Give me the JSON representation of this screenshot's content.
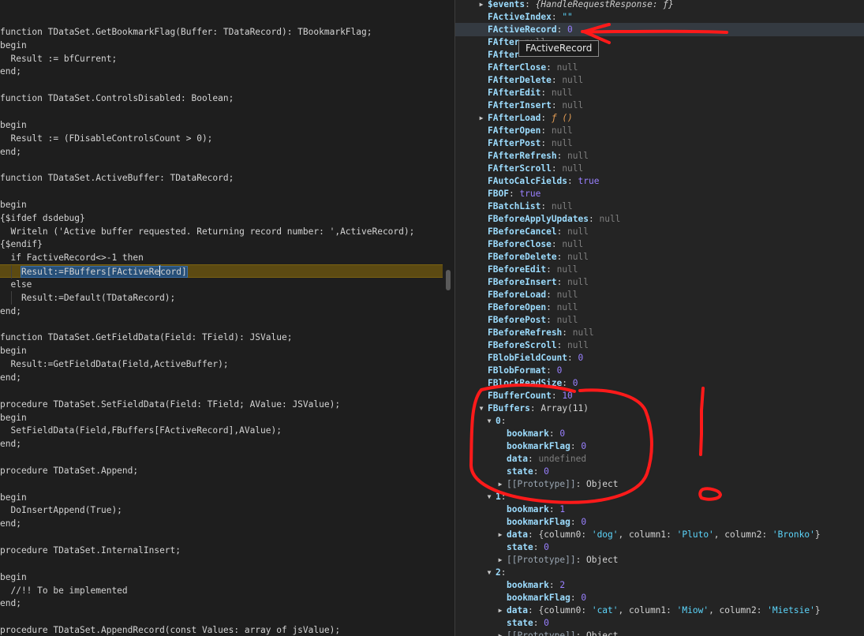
{
  "editor": {
    "lines": [
      "",
      "function TDataSet.GetBookmarkFlag(Buffer: TDataRecord): TBookmarkFlag;",
      "begin",
      "  Result := bfCurrent;",
      "end;",
      "",
      "function TDataSet.ControlsDisabled: Boolean;",
      "",
      "begin",
      "  Result := (FDisableControlsCount > 0);",
      "end;",
      "",
      "function TDataSet.ActiveBuffer: TDataRecord;",
      "",
      "begin",
      "{$ifdef dsdebug}",
      "  Writeln ('Active buffer requested. Returning record number: ',ActiveRecord);",
      "{$endif}",
      "  if FactiveRecord<>-1 then",
      "",
      "  else",
      "    Result:=Default(TDataRecord);",
      "end;",
      "",
      "function TDataSet.GetFieldData(Field: TField): JSValue;",
      "begin",
      "  Result:=GetFieldData(Field,ActiveBuffer);",
      "end;",
      "",
      "procedure TDataSet.SetFieldData(Field: TField; AValue: JSValue);",
      "begin",
      "  SetFieldData(Field,FBuffers[FActiveRecord],AValue);",
      "end;",
      "",
      "procedure TDataSet.Append;",
      "",
      "begin",
      "  DoInsertAppend(True);",
      "end;",
      "",
      "procedure TDataSet.InternalInsert;",
      "",
      "begin",
      "  //!! To be implemented",
      "end;",
      "",
      "procedure TDataSet.AppendRecord(const Values: array of jsValue);"
    ],
    "current_line": {
      "indent": "    ",
      "selected_before_caret": "Result:=FBuffers[FActiveRe",
      "selected_after_caret": "cord]"
    }
  },
  "scope": {
    "rows": [
      {
        "key": "$events",
        "sep": ": ",
        "value": "{HandleRequestResponse: ƒ}",
        "vclass": "v-italic",
        "twisty": "right"
      },
      {
        "key": "FActiveIndex",
        "sep": ": ",
        "value": "\"\"",
        "vclass": "v-str"
      },
      {
        "key": "FActiveRecord",
        "sep": ": ",
        "value": "0",
        "vclass": "v-num"
      },
      {
        "key": "FAfter",
        "sep": " ",
        "value": "null",
        "vclass": "v-null"
      },
      {
        "key": "FAfter",
        "sep": "",
        "value": "",
        "vclass": "v-null"
      },
      {
        "key": "FAfterClose",
        "sep": ": ",
        "value": "null",
        "vclass": "v-null"
      },
      {
        "key": "FAfterDelete",
        "sep": ": ",
        "value": "null",
        "vclass": "v-null"
      },
      {
        "key": "FAfterEdit",
        "sep": ": ",
        "value": "null",
        "vclass": "v-null"
      },
      {
        "key": "FAfterInsert",
        "sep": ": ",
        "value": "null",
        "vclass": "v-null"
      },
      {
        "key": "FAfterLoad",
        "sep": ": ",
        "value": "ƒ ()",
        "vclass": "v-fn",
        "twisty": "right"
      },
      {
        "key": "FAfterOpen",
        "sep": ": ",
        "value": "null",
        "vclass": "v-null"
      },
      {
        "key": "FAfterPost",
        "sep": ": ",
        "value": "null",
        "vclass": "v-null"
      },
      {
        "key": "FAfterRefresh",
        "sep": ": ",
        "value": "null",
        "vclass": "v-null"
      },
      {
        "key": "FAfterScroll",
        "sep": ": ",
        "value": "null",
        "vclass": "v-null"
      },
      {
        "key": "FAutoCalcFields",
        "sep": ": ",
        "value": "true",
        "vclass": "v-bool"
      },
      {
        "key": "FBOF",
        "sep": ": ",
        "value": "true",
        "vclass": "v-bool"
      },
      {
        "key": "FBatchList",
        "sep": ": ",
        "value": "null",
        "vclass": "v-null"
      },
      {
        "key": "FBeforeApplyUpdates",
        "sep": ": ",
        "value": "null",
        "vclass": "v-null"
      },
      {
        "key": "FBeforeCancel",
        "sep": ": ",
        "value": "null",
        "vclass": "v-null"
      },
      {
        "key": "FBeforeClose",
        "sep": ": ",
        "value": "null",
        "vclass": "v-null"
      },
      {
        "key": "FBeforeDelete",
        "sep": ": ",
        "value": "null",
        "vclass": "v-null"
      },
      {
        "key": "FBeforeEdit",
        "sep": ": ",
        "value": "null",
        "vclass": "v-null"
      },
      {
        "key": "FBeforeInsert",
        "sep": ": ",
        "value": "null",
        "vclass": "v-null"
      },
      {
        "key": "FBeforeLoad",
        "sep": ": ",
        "value": "null",
        "vclass": "v-null"
      },
      {
        "key": "FBeforeOpen",
        "sep": ": ",
        "value": "null",
        "vclass": "v-null"
      },
      {
        "key": "FBeforePost",
        "sep": ": ",
        "value": "null",
        "vclass": "v-null"
      },
      {
        "key": "FBeforeRefresh",
        "sep": ": ",
        "value": "null",
        "vclass": "v-null"
      },
      {
        "key": "FBeforeScroll",
        "sep": ": ",
        "value": "null",
        "vclass": "v-null"
      },
      {
        "key": "FBlobFieldCount",
        "sep": ": ",
        "value": "0",
        "vclass": "v-num"
      },
      {
        "key": "FBlobFormat",
        "sep": ": ",
        "value": "0",
        "vclass": "v-num"
      },
      {
        "key": "FBlockReadSize",
        "sep": ": ",
        "value": "0",
        "vclass": "v-num"
      },
      {
        "key": "FBufferCount",
        "sep": ": ",
        "value": "10",
        "vclass": "v-num"
      },
      {
        "key": "FBuffers",
        "sep": ": ",
        "value": "Array(11)",
        "vclass": "v-obj",
        "twisty": "down"
      },
      {
        "key": "0",
        "sep": ":",
        "value": "",
        "vclass": "v-obj",
        "twisty": "down",
        "level": 1
      },
      {
        "key": "bookmark",
        "sep": ": ",
        "value": "0",
        "vclass": "v-num",
        "level": 2
      },
      {
        "key": "bookmarkFlag",
        "sep": ": ",
        "value": "0",
        "vclass": "v-num",
        "level": 2
      },
      {
        "key": "data",
        "sep": ": ",
        "value": "undefined",
        "vclass": "v-null",
        "level": 2
      },
      {
        "key": "state",
        "sep": ": ",
        "value": "0",
        "vclass": "v-num",
        "level": 2
      },
      {
        "key": "[[Prototype]]",
        "sep": ": ",
        "value": "Object",
        "vclass": "v-obj",
        "twisty": "right",
        "level": 2,
        "dim": true
      },
      {
        "key": "1",
        "sep": ":",
        "value": "",
        "vclass": "v-obj",
        "twisty": "down",
        "level": 1
      },
      {
        "key": "bookmark",
        "sep": ": ",
        "value": "1",
        "vclass": "v-num",
        "level": 2
      },
      {
        "key": "bookmarkFlag",
        "sep": ": ",
        "value": "0",
        "vclass": "v-num",
        "level": 2
      },
      {
        "key": "data",
        "sep": ": ",
        "value": "",
        "vclass": "v-obj",
        "twisty": "right",
        "level": 2,
        "obj": [
          [
            "column0",
            "'dog'"
          ],
          [
            "column1",
            "'Pluto'"
          ],
          [
            "column2",
            "'Bronko'"
          ]
        ]
      },
      {
        "key": "state",
        "sep": ": ",
        "value": "0",
        "vclass": "v-num",
        "level": 2
      },
      {
        "key": "[[Prototype]]",
        "sep": ": ",
        "value": "Object",
        "vclass": "v-obj",
        "twisty": "right",
        "level": 2,
        "dim": true
      },
      {
        "key": "2",
        "sep": ":",
        "value": "",
        "vclass": "v-obj",
        "twisty": "down",
        "level": 1
      },
      {
        "key": "bookmark",
        "sep": ": ",
        "value": "2",
        "vclass": "v-num",
        "level": 2
      },
      {
        "key": "bookmarkFlag",
        "sep": ": ",
        "value": "0",
        "vclass": "v-num",
        "level": 2
      },
      {
        "key": "data",
        "sep": ": ",
        "value": "",
        "vclass": "v-obj",
        "twisty": "right",
        "level": 2,
        "obj": [
          [
            "column0",
            "'cat'"
          ],
          [
            "column1",
            "'Miow'"
          ],
          [
            "column2",
            "'Mietsie'"
          ]
        ]
      },
      {
        "key": "state",
        "sep": ": ",
        "value": "0",
        "vclass": "v-num",
        "level": 2
      },
      {
        "key": "[[Prototype]]",
        "sep": ": ",
        "value": "Object",
        "vclass": "v-obj",
        "twisty": "right",
        "level": 2,
        "dim": true
      }
    ],
    "tooltip": "FActiveRecord"
  },
  "colors": {
    "annotation": "#ff1a1a",
    "current_line_bg": "#5c4a12",
    "selection_bg": "#264f78"
  }
}
